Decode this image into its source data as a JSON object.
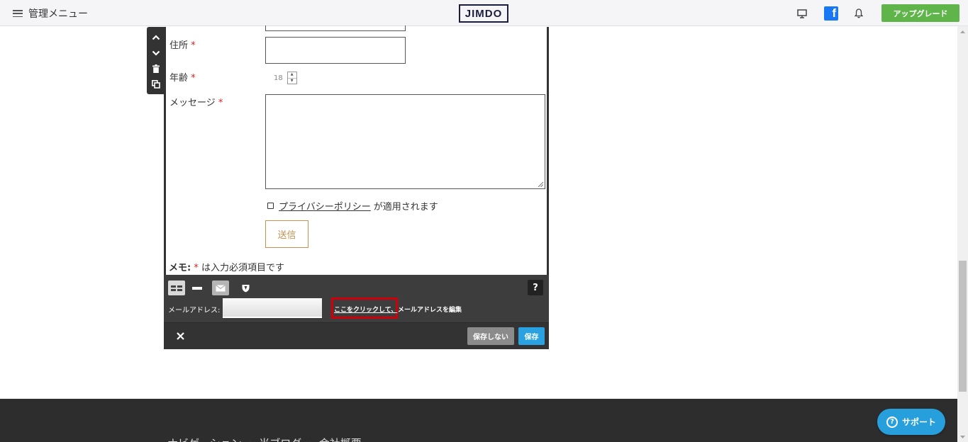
{
  "topbar": {
    "menu_label": "管理メニュー",
    "logo_text": "JIMDO",
    "facebook_letter": "f",
    "upgrade_label": "アップグレード"
  },
  "form": {
    "fields": [
      {
        "label": "住所",
        "required_mark": "*"
      },
      {
        "label": "年齢",
        "required_mark": "*",
        "value": "18"
      },
      {
        "label": "メッセージ",
        "required_mark": "*"
      }
    ],
    "consent_link": "プライバシーポリシー",
    "consent_suffix": "が適用されます",
    "submit_label": "送信",
    "memo_label": "メモ:",
    "memo_mark": "*",
    "memo_text": "は入力必須項目です"
  },
  "panel": {
    "help_label": "?",
    "email_label": "メールアドレス:",
    "click_here_link": "ここをクリックして、",
    "edit_suffix": "メールアドレスを編集",
    "cancel_label": "保存しない",
    "save_label": "保存"
  },
  "footer": {
    "text": "ナビゲーション ・ 当ブログ ・ 会社概要"
  },
  "support": {
    "icon_glyph": "?",
    "label": "サポート"
  },
  "colors": {
    "upgrade": "#60b54a",
    "save": "#2aa2e2",
    "highlight": "#d0000b",
    "submit": "#c9914f",
    "required": "#dd2222"
  }
}
